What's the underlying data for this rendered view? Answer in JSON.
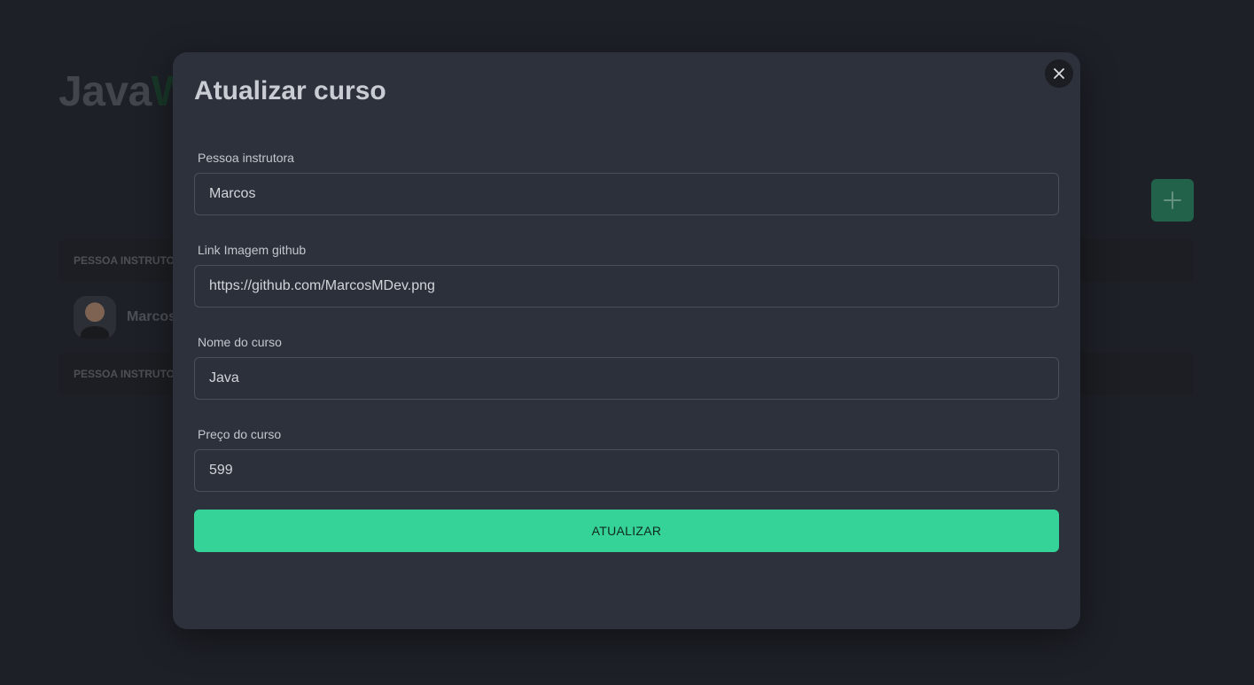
{
  "background": {
    "logo": {
      "part1": "Java",
      "part2": "W"
    },
    "table": {
      "header_label": "PESSOA INSTRUTOR",
      "row_name": "Marcos",
      "footer_label": "PESSOA INSTRUTOR"
    },
    "add_icon": "plus-icon"
  },
  "modal": {
    "title": "Atualizar curso",
    "close_icon": "close-icon",
    "fields": [
      {
        "label": "Pessoa instrutora",
        "value": "Marcos"
      },
      {
        "label": "Link Imagem github",
        "value": "https://github.com/MarcosMDev.png"
      },
      {
        "label": "Nome do curso",
        "value": "Java"
      },
      {
        "label": "Preço do curso",
        "value": "599"
      }
    ],
    "submit_label": "ATUALIZAR"
  },
  "colors": {
    "accent": "#36d399",
    "modal_bg": "#2c313c",
    "page_bg": "#23262e"
  }
}
